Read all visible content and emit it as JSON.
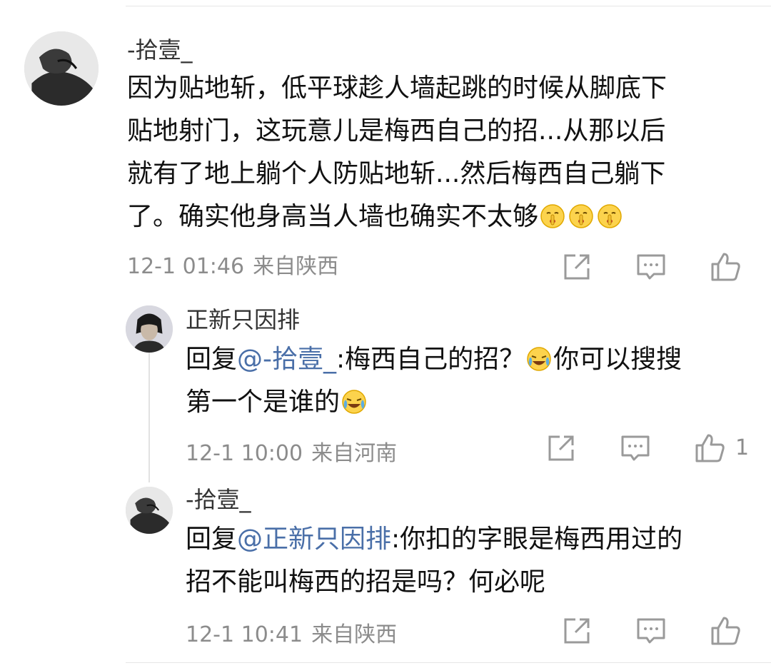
{
  "comments": [
    {
      "username": "-拾壹_",
      "lines": [
        "因为贴地斩，低平球趁人墙起跳的时候从脚底下",
        "贴地射门，这玩意儿是梅西自己的招...从那以后",
        "就有了地上躺个人防贴地斩...然后梅西自己躺下",
        "了。确实他身高当人墙也确实不太够"
      ],
      "time": "12-1 01:46",
      "location": "来自陕西",
      "emoji_names": [
        "shush-face-emoji",
        "shush-face-emoji",
        "shush-face-emoji"
      ]
    }
  ],
  "replies": [
    {
      "username": "正新只因排",
      "prefix": "回复",
      "mention": "@-拾壹_",
      "line1_rest": ":梅西自己的招？",
      "line1_tail": "你可以搜搜",
      "line2": "第一个是谁的",
      "time": "12-1 10:00",
      "location": "来自河南",
      "like_count": "1",
      "emoji_name": "laugh-cry-emoji"
    },
    {
      "username": "-拾壹_",
      "prefix": "回复",
      "mention": "@正新只因排",
      "line1_rest": ":你扣的字眼是梅西用过的",
      "line2": "招不能叫梅西的招是吗？何必呢",
      "time": "12-1 10:41",
      "location": "来自陕西"
    }
  ],
  "colors": {
    "mention": "#4a6fa8",
    "meta": "#8c8c8c",
    "icon": "#9a9a9a"
  },
  "icons": [
    "share-icon",
    "comment-icon",
    "like-icon"
  ]
}
